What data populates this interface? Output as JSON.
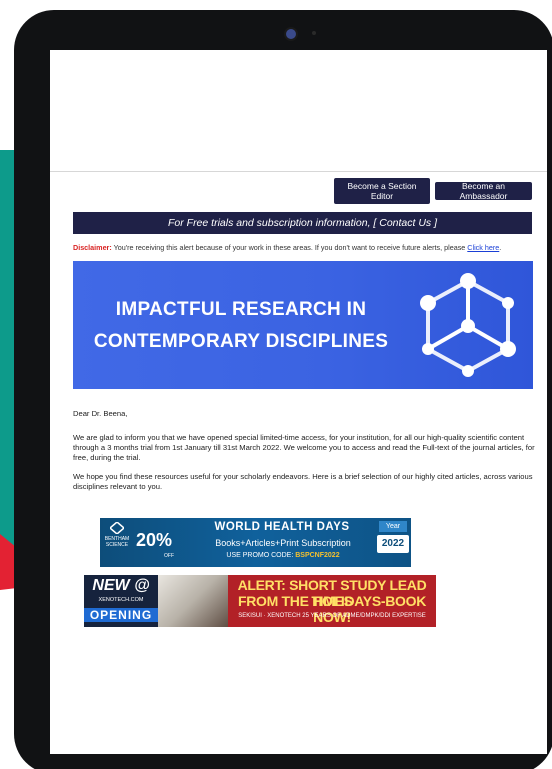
{
  "buttons": {
    "section_editor": "Become a Section Editor",
    "ambassador": "Become an Ambassador"
  },
  "trial_banner": "For Free trials and subscription information, [ Contact Us ]",
  "disclaimer": {
    "label": "Disclaimer:",
    "text": " You're receiving this alert because of your work in these areas. If you don't want to receive future alerts, please ",
    "link": "Click here",
    "end": "."
  },
  "hero": {
    "line1": "IMPACTFUL RESEARCH IN",
    "line2": "CONTEMPORARY DISCIPLINES"
  },
  "greeting": "Dear Dr. Beena,",
  "paragraphs": [
    "We are glad to inform you that we have opened special limited-time access, for your institution, for all our high-quality scientific content through a 3 months trial from 1st January till 31st March 2022. We welcome you to access and read the Full-text of the journal articles, for free, during the trial.",
    "We hope you find these resources useful for your scholarly endeavors. Here is a brief selection of our highly cited articles, across various disciplines relevant to you."
  ],
  "ad_world_health": {
    "logo": "BENTHAM SCIENCE",
    "percent": "20%",
    "off": "OFF",
    "title": "WORLD HEALTH DAYS",
    "subtitle": "Books+Articles+Print Subscription",
    "promo_label": "USE PROMO CODE: ",
    "promo_code": "BSPCNF2022",
    "year_label": "Year",
    "year": "2022"
  },
  "ad_xenotech": {
    "new": "NEW @",
    "domain": "XENOTECH.COM",
    "opening": "OPENING",
    "line1": "ALERT: SHORT STUDY LEAD TIMES",
    "line2": "FROM THE HOLIDAYS-BOOK NOW!",
    "line3": "SEKISUI · XENOTECH 25 YEARS OF ADME/DMPK/DDI EXPERTISE"
  },
  "colors": {
    "navy": "#1f2147",
    "teal": "#0d9b8b",
    "red": "#e32233",
    "hero_blue": "#3b63e2"
  }
}
